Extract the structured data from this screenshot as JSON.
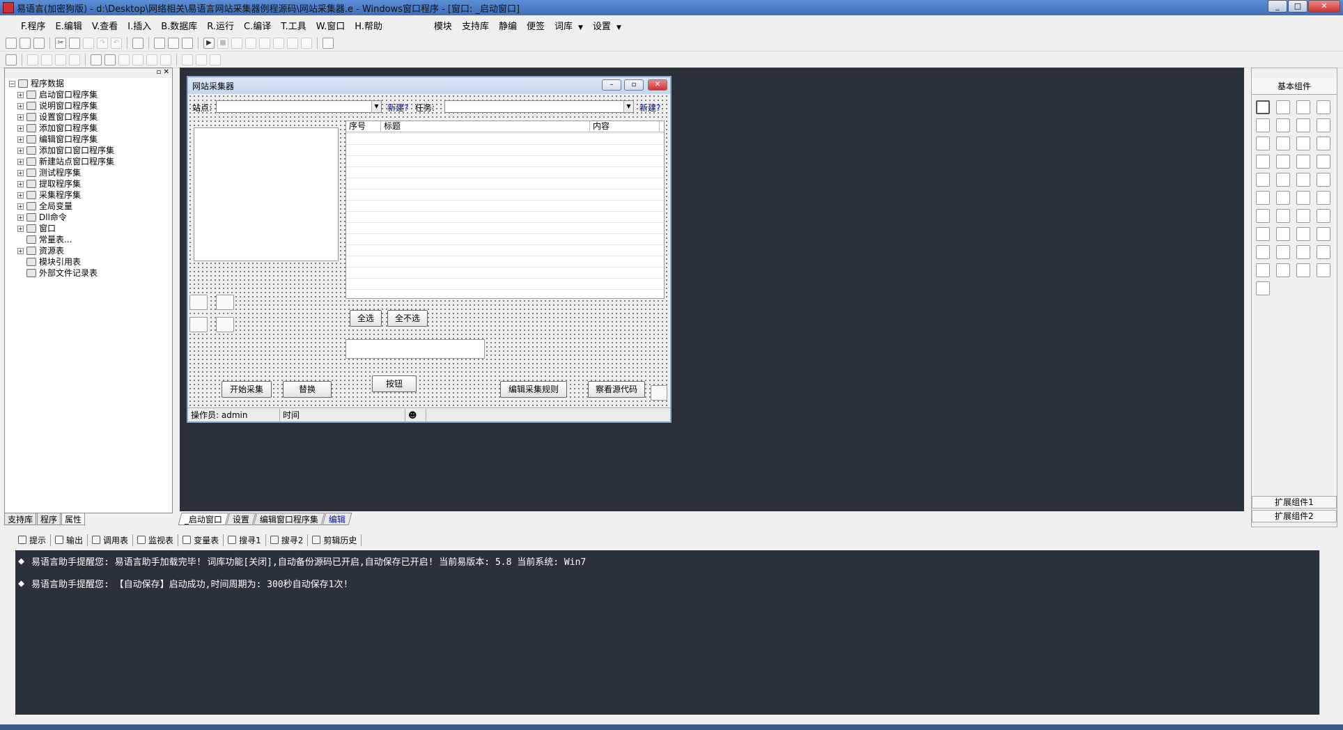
{
  "titlebar": {
    "title": "易语言(加密狗版) - d:\\Desktop\\网络相关\\易语言网站采集器例程源码\\网站采集器.e - Windows窗口程序 - [窗口: _启动窗口]",
    "min": "_",
    "max": "□",
    "close": "✕"
  },
  "menu": {
    "items": [
      "F.程序",
      "E.编辑",
      "V.查看",
      "I.插入",
      "B.数据库",
      "R.运行",
      "C.编译",
      "T.工具",
      "W.窗口",
      "H.帮助"
    ],
    "extras": [
      "模块",
      "支持库",
      "静编",
      "便签",
      "词库",
      "设置"
    ]
  },
  "tree": {
    "root": "程序数据",
    "items": [
      "启动窗口程序集",
      "说明窗口程序集",
      "设置窗口程序集",
      "添加窗口程序集",
      "编辑窗口程序集",
      "添加窗口窗口程序集",
      "新建站点窗口程序集",
      "测试程序集",
      "提取程序集",
      "采集程序集",
      "全局变量",
      "Dll命令",
      "窗口",
      "常量表...",
      "资源表",
      "模块引用表",
      "外部文件记录表"
    ]
  },
  "left_tabs": [
    "支持库",
    "程序",
    "属性"
  ],
  "form": {
    "title": "网站采集器",
    "site_label": "站点:",
    "new1": "新建?",
    "task_label": "任务:",
    "new2": "新建?",
    "columns": [
      "序号",
      "标题",
      "内容"
    ],
    "select_all": "全选",
    "select_none": "全不选",
    "button": "按钮",
    "start": "开始采集",
    "replace": "替换",
    "edit_rules": "编辑采集规则",
    "view_source": "察看源代码",
    "status_operator": "操作员: admin",
    "status_time": "时间"
  },
  "doc_tabs": [
    "_启动窗口",
    "设置",
    "编辑窗口程序集",
    "编辑"
  ],
  "palette": {
    "header": "基本组件",
    "ext1": "扩展组件1",
    "ext2": "扩展组件2"
  },
  "bottom_tabs": [
    "提示",
    "输出",
    "调用表",
    "监视表",
    "变量表",
    "搜寻1",
    "搜寻2",
    "剪辑历史"
  ],
  "output": [
    "易语言助手提醒您:  易语言助手加载完毕!  词库功能[关闭],自动备份源码已开启,自动保存已开启!  当前易版本: 5.8  当前系统: Win7",
    "易语言助手提醒您: 【自动保存】启动成功,时间周期为: 300秒自动保存1次!"
  ],
  "output_bullet": "◆",
  "colors": {
    "workspace": "#2b313b",
    "link": "#0010c0"
  }
}
